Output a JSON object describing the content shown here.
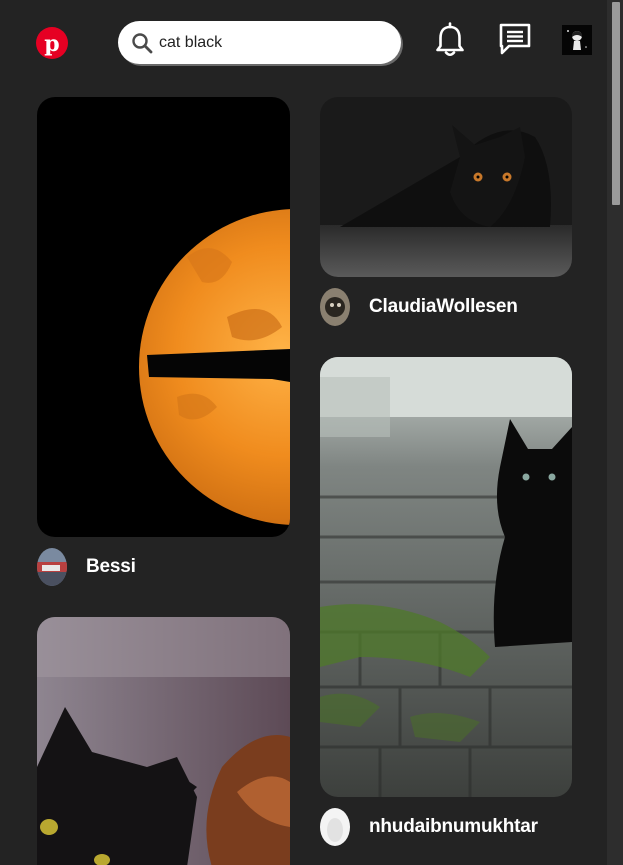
{
  "header": {
    "logo": {
      "icon": "pinterest-logo-icon",
      "color": "#e60023"
    },
    "search": {
      "value": "cat black",
      "placeholder": "Search"
    },
    "icons": [
      "bell-icon",
      "message-icon",
      "profile-avatar"
    ]
  },
  "pins": [
    {
      "id": "moon",
      "author": "Bessi",
      "image": "orange-moon-branch-silhouette"
    },
    {
      "id": "cat-lying",
      "author": "ClaudiaWollesen",
      "image": "black-cat-lying-dark"
    },
    {
      "id": "kitten",
      "author": "nhudaibnumukhtar",
      "image": "black-kitten-on-mossy-bricks"
    },
    {
      "id": "cat-dog",
      "author": "",
      "image": "black-cat-and-dog"
    }
  ],
  "colors": {
    "background": "#232323",
    "text": "#ffffff",
    "search_bg": "#ffffff"
  }
}
